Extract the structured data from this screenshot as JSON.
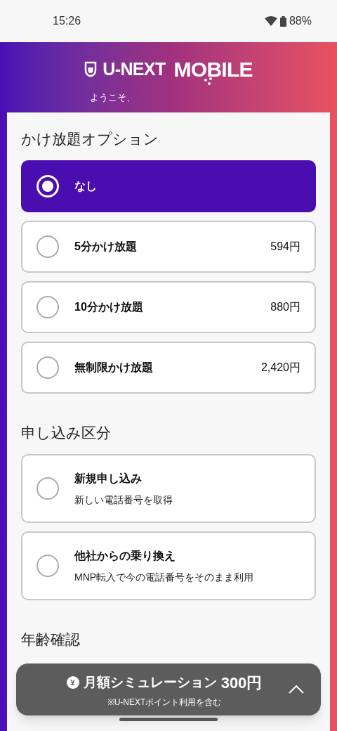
{
  "status_bar": {
    "time": "15:26",
    "battery": "88%"
  },
  "header": {
    "brand": "U-NEXT",
    "product": "MOBILE",
    "welcome": "ようこそ、"
  },
  "sections": [
    {
      "title": "かけ放題オプション",
      "options": [
        {
          "label": "なし",
          "selected": true
        },
        {
          "label": "5分かけ放題",
          "price": "594円",
          "selected": false
        },
        {
          "label": "10分かけ放題",
          "price": "880円",
          "selected": false
        },
        {
          "label": "無制限かけ放題",
          "price": "2,420円",
          "selected": false
        }
      ]
    },
    {
      "title": "申し込み区分",
      "options": [
        {
          "label": "新規申し込み",
          "description": "新しい電話番号を取得",
          "selected": false
        },
        {
          "label": "他社からの乗り換え",
          "description": "MNP転入で今の電話番号をそのまま利用",
          "selected": false
        }
      ]
    },
    {
      "title": "年齢確認"
    }
  ],
  "simulation_bar": {
    "currency_icon": "¥",
    "title": "月額シミュレーション",
    "amount": "300円",
    "note": "※U-NEXTポイント利用を含む"
  }
}
